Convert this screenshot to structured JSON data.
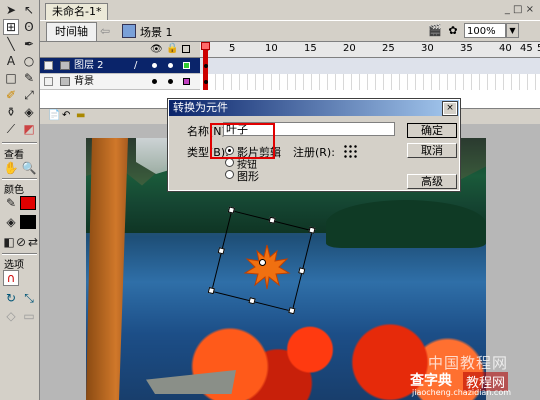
{
  "document_tab": "未命名-1*",
  "window_buttons": "_ □ ×",
  "editbar": {
    "timeline_button": "时间轴",
    "scene_label": "场景 1",
    "zoom": "100%"
  },
  "toolbox": {
    "view_label": "查看",
    "colors_label": "颜色",
    "options_label": "选项"
  },
  "timeline": {
    "frame_numbers": [
      "1",
      "5",
      "10",
      "15",
      "20",
      "25",
      "30",
      "35",
      "40",
      "45",
      "50",
      "55"
    ],
    "layers": [
      {
        "name": "图层 2",
        "active": true
      },
      {
        "name": "背景",
        "active": false
      }
    ]
  },
  "dialog": {
    "title": "转换为元件",
    "name_label": "名称(N):",
    "name_value": "叶子",
    "type_label": "类型(B):",
    "registration_label": "注册(R):",
    "types": [
      {
        "label": "影片剪辑",
        "selected": true
      },
      {
        "label": "按钮",
        "selected": false
      },
      {
        "label": "图形",
        "selected": false
      }
    ],
    "ok": "确定",
    "cancel": "取消",
    "advanced": "高级"
  },
  "watermark": {
    "line1": "中国教程网",
    "brand": "查字典",
    "tag": "教程网",
    "url": "jiaocheng.chazidian.com"
  },
  "colors": {
    "title_bar": "#0a246a",
    "stroke_swatch": "#000000",
    "fill_swatch": "#e00000",
    "highlight": "#e00000"
  }
}
